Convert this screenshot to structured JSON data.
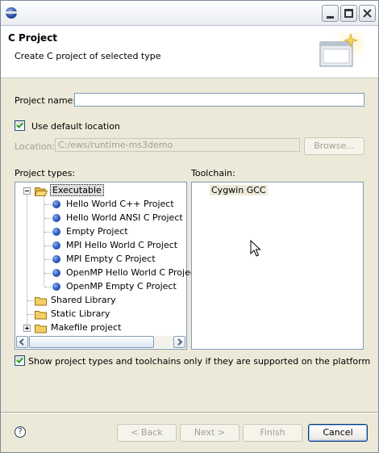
{
  "header": {
    "title": "C Project",
    "subtitle": "Create C project of selected type"
  },
  "form": {
    "project_name_label": "Project name:",
    "project_name_value": "",
    "use_default_location_label": "Use default location",
    "use_default_location_checked": true,
    "location_label": "Location:",
    "location_value": "C:/ews/runtime-ms3demo",
    "browse_label": "Browse..."
  },
  "project_types": {
    "label": "Project types:",
    "items": [
      {
        "label": "Executable",
        "expanded": true,
        "selected": true,
        "children": [
          {
            "label": "Hello World C++ Project"
          },
          {
            "label": "Hello World ANSI C Project"
          },
          {
            "label": "Empty Project"
          },
          {
            "label": "MPI Hello World C Project"
          },
          {
            "label": "MPI Empty C Project"
          },
          {
            "label": "OpenMP Hello World C Project"
          },
          {
            "label": "OpenMP Empty C Project"
          }
        ]
      },
      {
        "label": "Shared Library"
      },
      {
        "label": "Static Library"
      },
      {
        "label": "Makefile project",
        "expanded": false
      }
    ]
  },
  "toolchain": {
    "label": "Toolchain:",
    "items": [
      "Cygwin GCC"
    ]
  },
  "filter": {
    "label": "Show project types and toolchains only if they are supported on the platform",
    "checked": true
  },
  "buttons": {
    "back": "< Back",
    "next": "Next >",
    "finish": "Finish",
    "cancel": "Cancel"
  },
  "colors": {
    "accent": "#003c74",
    "bullet": "#2e5cc0",
    "folder": "#f0c34a"
  }
}
